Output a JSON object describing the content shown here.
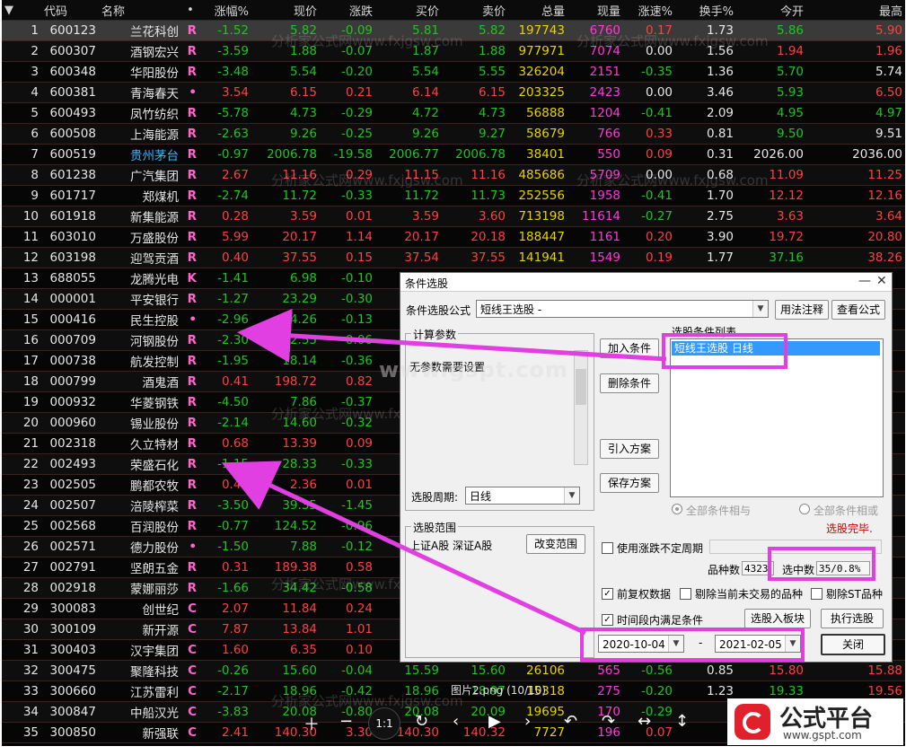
{
  "table": {
    "headers": {
      "code": "代码",
      "name": "名称",
      "dot": "•",
      "chg_pct": "涨幅%",
      "price": "现价",
      "chg": "涨跌",
      "bid": "买价",
      "ask": "卖价",
      "vol": "总量",
      "cur": "现量",
      "speed": "涨速%",
      "turn": "换手%",
      "open": "今开",
      "high": "最高"
    },
    "rows": [
      {
        "n": "1",
        "code": "600123",
        "name": "兰花科创",
        "flag": "R",
        "chg_pct": "-1.52",
        "price": "5.82",
        "chg": "-0.09",
        "bid": "5.81",
        "ask": "5.82",
        "vol": "197743",
        "cur": "6760",
        "speed": "0.17",
        "turn": "1.73",
        "open": "5.86",
        "high": "5.90",
        "dir": "dn",
        "sp": "up",
        "op": "dn",
        "hi": "up"
      },
      {
        "n": "2",
        "code": "600307",
        "name": "酒钢宏兴",
        "flag": "R",
        "chg_pct": "-3.59",
        "price": "1.88",
        "chg": "-0.07",
        "bid": "1.87",
        "ask": "1.88",
        "vol": "977971",
        "cur": "7074",
        "speed": "0.00",
        "turn": "1.56",
        "open": "1.94",
        "high": "1.96",
        "dir": "dn",
        "sp": "flat",
        "op": "up",
        "hi": "up"
      },
      {
        "n": "3",
        "code": "600348",
        "name": "华阳股份",
        "flag": "R",
        "chg_pct": "-3.48",
        "price": "5.54",
        "chg": "-0.20",
        "bid": "5.54",
        "ask": "5.55",
        "vol": "326204",
        "cur": "2151",
        "speed": "-0.35",
        "turn": "1.36",
        "open": "5.70",
        "high": "5.74",
        "dir": "dn",
        "sp": "dn",
        "op": "dn",
        "hi": "flat"
      },
      {
        "n": "4",
        "code": "600381",
        "name": "青海春天",
        "flag": "•",
        "chg_pct": "3.54",
        "price": "6.15",
        "chg": "0.21",
        "bid": "6.14",
        "ask": "6.15",
        "vol": "203325",
        "cur": "2423",
        "speed": "0.00",
        "turn": "3.46",
        "open": "5.93",
        "high": "6.50",
        "dir": "up",
        "sp": "flat",
        "op": "dn",
        "hi": "up"
      },
      {
        "n": "5",
        "code": "600493",
        "name": "凤竹纺织",
        "flag": "R",
        "chg_pct": "-5.78",
        "price": "4.73",
        "chg": "-0.29",
        "bid": "4.72",
        "ask": "4.73",
        "vol": "56888",
        "cur": "1204",
        "speed": "-0.41",
        "turn": "2.09",
        "open": "4.95",
        "high": "4.97",
        "dir": "dn",
        "sp": "dn",
        "op": "dn",
        "hi": "dn"
      },
      {
        "n": "6",
        "code": "600508",
        "name": "上海能源",
        "flag": "R",
        "chg_pct": "-2.63",
        "price": "9.26",
        "chg": "-0.25",
        "bid": "9.26",
        "ask": "9.27",
        "vol": "58679",
        "cur": "766",
        "speed": "0.33",
        "turn": "0.81",
        "open": "9.50",
        "high": "9.51",
        "dir": "dn",
        "sp": "up",
        "op": "dn",
        "hi": "flat"
      },
      {
        "n": "7",
        "code": "600519",
        "name": "贵州茅台",
        "flag": "R",
        "chg_pct": "-0.97",
        "price": "2006.78",
        "chg": "-19.58",
        "bid": "2006.77",
        "ask": "2006.78",
        "vol": "38401",
        "cur": "550",
        "speed": "0.09",
        "turn": "0.31",
        "open": "2026.00",
        "high": "2036.00",
        "dir": "dn",
        "sp": "up",
        "op": "flat",
        "hi": "flat",
        "hl": true
      },
      {
        "n": "8",
        "code": "601238",
        "name": "广汽集团",
        "flag": "R",
        "chg_pct": "2.67",
        "price": "11.16",
        "chg": "0.29",
        "bid": "11.15",
        "ask": "11.16",
        "vol": "485686",
        "cur": "5709",
        "speed": "0.00",
        "turn": "0.68",
        "open": "11.09",
        "high": "11.25",
        "dir": "up",
        "sp": "flat",
        "op": "up",
        "hi": "up"
      },
      {
        "n": "9",
        "code": "601717",
        "name": "郑煤机",
        "flag": "R",
        "chg_pct": "-2.74",
        "price": "11.72",
        "chg": "-0.33",
        "bid": "11.72",
        "ask": "11.73",
        "vol": "252556",
        "cur": "1958",
        "speed": "-0.41",
        "turn": "1.70",
        "open": "12.12",
        "high": "12.16",
        "dir": "dn",
        "sp": "dn",
        "op": "up",
        "hi": "up"
      },
      {
        "n": "10",
        "code": "601918",
        "name": "新集能源",
        "flag": "R",
        "chg_pct": "0.28",
        "price": "3.59",
        "chg": "0.01",
        "bid": "3.59",
        "ask": "3.60",
        "vol": "713198",
        "cur": "11614",
        "speed": "-0.27",
        "turn": "2.75",
        "open": "3.63",
        "high": "3.64",
        "dir": "up",
        "sp": "dn",
        "op": "up",
        "hi": "up"
      },
      {
        "n": "11",
        "code": "603010",
        "name": "万盛股份",
        "flag": "R",
        "chg_pct": "5.99",
        "price": "20.17",
        "chg": "1.14",
        "bid": "20.17",
        "ask": "20.18",
        "vol": "188447",
        "cur": "1161",
        "speed": "0.20",
        "turn": "3.90",
        "open": "19.72",
        "high": "20.80",
        "dir": "up",
        "sp": "up",
        "op": "up",
        "hi": "up"
      },
      {
        "n": "12",
        "code": "603198",
        "name": "迎驾贡酒",
        "flag": "R",
        "chg_pct": "0.40",
        "price": "37.55",
        "chg": "0.15",
        "bid": "37.54",
        "ask": "37.55",
        "vol": "141941",
        "cur": "1549",
        "speed": "0.19",
        "turn": "1.77",
        "open": "37.16",
        "high": "38.26",
        "dir": "up",
        "sp": "up",
        "op": "dn",
        "hi": "up"
      },
      {
        "n": "13",
        "code": "688055",
        "name": "龙腾光电",
        "flag": "K",
        "chg_pct": "-1.41",
        "price": "6.98",
        "chg": "-0.10",
        "dir": "dn"
      },
      {
        "n": "14",
        "code": "000001",
        "name": "平安银行",
        "flag": "R",
        "chg_pct": "-1.27",
        "price": "23.29",
        "chg": "-0.30",
        "dir": "dn"
      },
      {
        "n": "15",
        "code": "000416",
        "name": "民生控股",
        "flag": "•",
        "chg_pct": "-2.96",
        "price": "4.26",
        "chg": "-0.13",
        "dir": "dn"
      },
      {
        "n": "16",
        "code": "000709",
        "name": "河钢股份",
        "flag": "R",
        "chg_pct": "-2.30",
        "price": "2.55",
        "chg": "-0.06",
        "dir": "dn"
      },
      {
        "n": "17",
        "code": "000738",
        "name": "航发控制",
        "flag": "R",
        "chg_pct": "-1.95",
        "price": "18.14",
        "chg": "-0.36",
        "dir": "dn"
      },
      {
        "n": "18",
        "code": "000799",
        "name": "酒鬼酒",
        "flag": "R",
        "chg_pct": "0.41",
        "price": "198.72",
        "chg": "0.82",
        "dir": "up"
      },
      {
        "n": "19",
        "code": "000932",
        "name": "华菱钢铁",
        "flag": "R",
        "chg_pct": "-4.50",
        "price": "7.86",
        "chg": "-0.37",
        "dir": "dn"
      },
      {
        "n": "20",
        "code": "000960",
        "name": "锡业股份",
        "flag": "R",
        "chg_pct": "-2.14",
        "price": "14.60",
        "chg": "-0.32",
        "dir": "dn"
      },
      {
        "n": "21",
        "code": "002318",
        "name": "久立特材",
        "flag": "R",
        "chg_pct": "0.68",
        "price": "13.39",
        "chg": "0.09",
        "dir": "up"
      },
      {
        "n": "22",
        "code": "002493",
        "name": "荣盛石化",
        "flag": "R",
        "chg_pct": "-1.15",
        "price": "28.33",
        "chg": "-0.33",
        "dir": "dn"
      },
      {
        "n": "23",
        "code": "002505",
        "name": "鹏都农牧",
        "flag": "R",
        "chg_pct": "0.43",
        "price": "2.36",
        "chg": "0.01",
        "dir": "up"
      },
      {
        "n": "24",
        "code": "002507",
        "name": "涪陵榨菜",
        "flag": "R",
        "chg_pct": "-3.50",
        "price": "39.35",
        "chg": "-1.45",
        "dir": "dn"
      },
      {
        "n": "25",
        "code": "002568",
        "name": "百润股份",
        "flag": "R",
        "chg_pct": "-0.77",
        "price": "124.52",
        "chg": "-0.96",
        "dir": "dn"
      },
      {
        "n": "26",
        "code": "002571",
        "name": "德力股份",
        "flag": "•",
        "chg_pct": "-1.50",
        "price": "7.88",
        "chg": "-0.12",
        "dir": "dn"
      },
      {
        "n": "27",
        "code": "002791",
        "name": "坚朗五金",
        "flag": "R",
        "chg_pct": "0.31",
        "price": "189.38",
        "chg": "0.58",
        "dir": "up"
      },
      {
        "n": "28",
        "code": "002918",
        "name": "蒙娜丽莎",
        "flag": "R",
        "chg_pct": "-1.66",
        "price": "34.42",
        "chg": "-0.58",
        "dir": "dn"
      },
      {
        "n": "29",
        "code": "300083",
        "name": "创世纪",
        "flag": "C",
        "chg_pct": "2.07",
        "price": "11.84",
        "chg": "0.24",
        "dir": "up"
      },
      {
        "n": "30",
        "code": "300109",
        "name": "新开源",
        "flag": "C",
        "chg_pct": "7.87",
        "price": "13.84",
        "chg": "1.01",
        "dir": "up"
      },
      {
        "n": "31",
        "code": "300403",
        "name": "汉宇集团",
        "flag": "C",
        "chg_pct": "1.60",
        "price": "6.35",
        "chg": "0.10",
        "dir": "up"
      },
      {
        "n": "32",
        "code": "300475",
        "name": "聚隆科技",
        "flag": "C",
        "chg_pct": "-0.26",
        "price": "15.60",
        "chg": "-0.04",
        "bid": "15.59",
        "ask": "15.60",
        "vol": "26106",
        "cur": "565",
        "speed": "-0.56",
        "turn": "0.85",
        "open": "15.80",
        "high": "15.88",
        "dir": "dn",
        "sp": "dn",
        "op": "up",
        "hi": "up"
      },
      {
        "n": "33",
        "code": "300660",
        "name": "江苏雷利",
        "flag": "C",
        "chg_pct": "-2.17",
        "price": "18.96",
        "chg": "-0.42",
        "bid": "18.96",
        "ask": "18.97",
        "vol": "15318",
        "cur": "275",
        "speed": "-0.20",
        "turn": "1.23",
        "open": "19.33",
        "high": "19.56",
        "dir": "dn",
        "sp": "dn",
        "op": "dn",
        "hi": "up"
      },
      {
        "n": "34",
        "code": "300847",
        "name": "中船汉光",
        "flag": "C",
        "chg_pct": "-3.83",
        "price": "20.08",
        "chg": "-0.80",
        "bid": "20.08",
        "ask": "20.09",
        "vol": "19695",
        "cur": "170",
        "speed": "-0.29",
        "turn": "",
        "open": "",
        "high": "",
        "dir": "dn",
        "sp": "dn"
      },
      {
        "n": "35",
        "code": "300850",
        "name": "新强联",
        "flag": "C",
        "chg_pct": "2.41",
        "price": "140.30",
        "chg": "3.30",
        "bid": "140.30",
        "ask": "140.32",
        "vol": "7727",
        "cur": "196",
        "speed": "0.07",
        "turn": "",
        "open": "",
        "high": "",
        "dir": "up",
        "sp": "up"
      }
    ]
  },
  "watermarks": {
    "site": "www.gspt.com",
    "fx1": "分析家公式网www.fxjgsw.com",
    "fx2": "www.fxjgsw.com"
  },
  "dialog": {
    "title": "条件选股",
    "formula_label": "条件选股公式",
    "formula_value": "短线王选股   -",
    "usage_btn": "用法注释",
    "view_btn": "查看公式",
    "calc_group": "计算参数",
    "no_params": "无参数需要设置",
    "cond_list_label": "选股条件列表",
    "cond_item": "短线王选股   日线",
    "add_btn": "加入条件",
    "del_btn": "删除条件",
    "import_btn": "引入方案",
    "save_btn": "保存方案",
    "period_label": "选股周期:",
    "period_value": "日线",
    "radio_and": "全部条件相与",
    "radio_or": "全部条件相或",
    "done": "选股完毕.",
    "range_group": "选股范围",
    "range_value": "上证A股  深证A股",
    "change_range_btn": "改变范围",
    "use_period": "使用涨跌不定周期",
    "count_label": "品种数",
    "count_value": "4323",
    "selected_label": "选中数",
    "selected_value": "35/0.8%",
    "fq": "前复权数据",
    "excl_untraded": "剔除当前未交易的品种",
    "excl_st": "剔除ST品种",
    "time_cond": "时间段内满足条件",
    "to_board_btn": "选股入板块",
    "run_btn": "执行选股",
    "date_from": "2020-10-04",
    "dash": "-",
    "date_to": "2021-02-05",
    "close_btn": "关闭"
  },
  "viewer": {
    "caption": "图片2.png (10/10)",
    "zoom_label": "1:1"
  },
  "logo": {
    "text": "公式平台",
    "url": "www.gspt.com"
  },
  "colors": {
    "up": "#ff4040",
    "down": "#22c322",
    "volume": "#e8d200",
    "accent": "#e23fe2"
  }
}
